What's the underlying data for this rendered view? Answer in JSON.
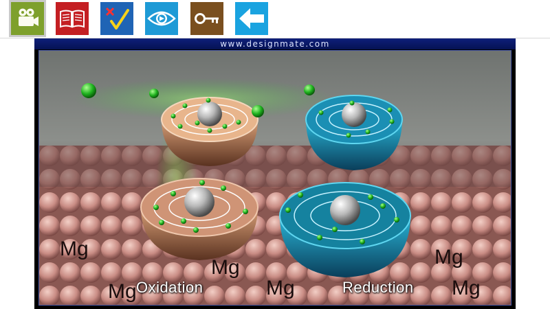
{
  "toolbar": {
    "buttons": [
      {
        "icon": "video-camera-icon",
        "color": "#7ea02c"
      },
      {
        "icon": "open-book-icon",
        "color": "#c41f23"
      },
      {
        "icon": "quiz-check-icon",
        "color": "#1f64b5"
      },
      {
        "icon": "eye-icon",
        "color": "#1e9ad6"
      },
      {
        "icon": "key-icon",
        "color": "#7a4f1f"
      },
      {
        "icon": "back-arrow-icon",
        "color": "#1aa3e0"
      }
    ]
  },
  "video": {
    "watermark": "www.designmate.com",
    "surface_label": "Mg",
    "captions": {
      "left": "Oxidation",
      "right": "Reduction"
    }
  }
}
